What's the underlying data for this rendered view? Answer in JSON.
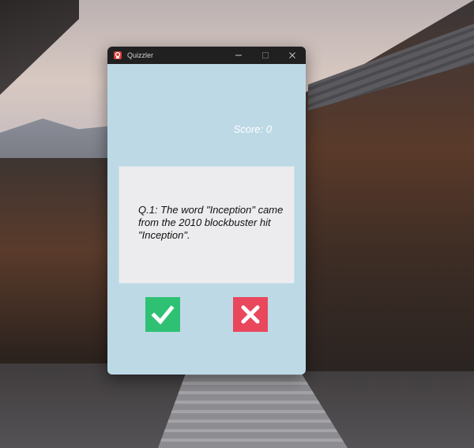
{
  "window": {
    "title": "Quizzler",
    "controls": {
      "minimize_icon": "minimize-icon",
      "maximize_icon": "maximize-icon",
      "close_icon": "close-icon"
    }
  },
  "score": {
    "label": "Score: 0"
  },
  "question": {
    "text": "Q.1: The word \"Inception\" came from the 2010 blockbuster hit \"Inception\"."
  },
  "buttons": {
    "true_icon": "check-icon",
    "false_icon": "cross-icon"
  },
  "colors": {
    "window_bg": "#bdd9e6",
    "card_bg": "#ececee",
    "true_button": "#2fc173",
    "false_button": "#e8475c",
    "titlebar": "#202020"
  }
}
